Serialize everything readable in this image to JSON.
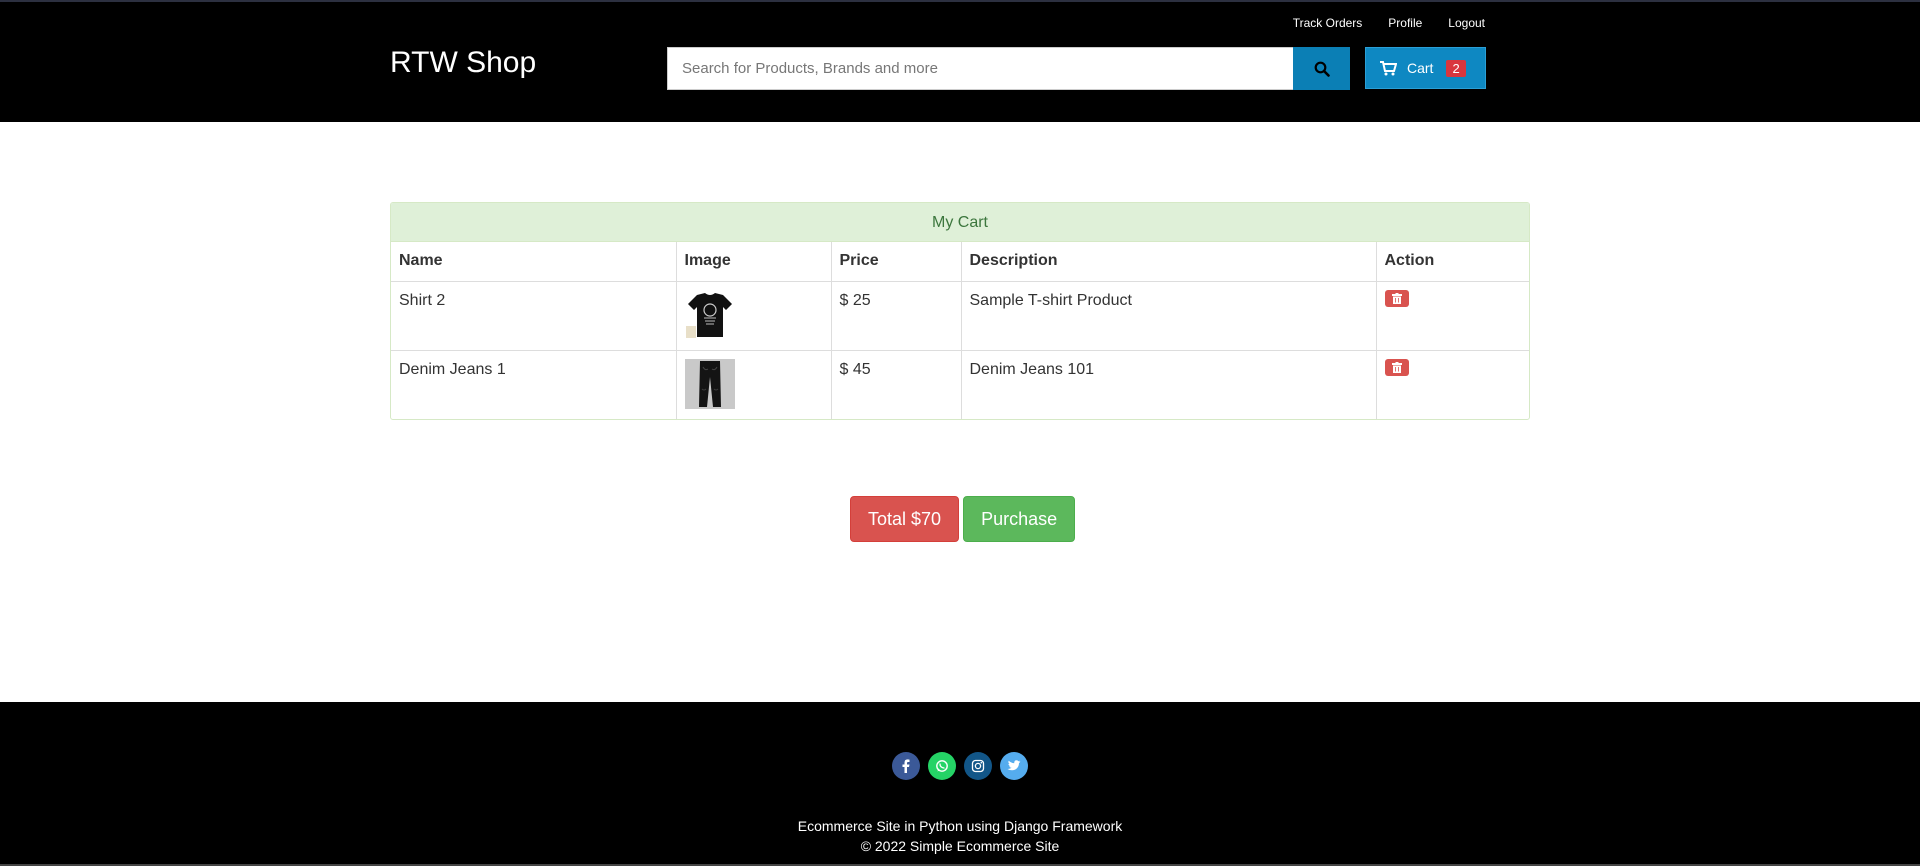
{
  "header": {
    "brand": "RTW Shop",
    "top_links": [
      "Track Orders",
      "Profile",
      "Logout"
    ],
    "search_placeholder": "Search for Products, Brands and more",
    "cart_label": "Cart",
    "cart_count": "2"
  },
  "cart": {
    "title": "My Cart",
    "columns": [
      "Name",
      "Image",
      "Price",
      "Description",
      "Action"
    ],
    "rows": [
      {
        "name": "Shirt 2",
        "image": "tshirt-image",
        "price": "$ 25",
        "description": "Sample T-shirt Product"
      },
      {
        "name": "Denim Jeans 1",
        "image": "jeans-image",
        "price": "$ 45",
        "description": "Denim Jeans 101"
      }
    ]
  },
  "summary": {
    "total_label": "Total $70",
    "purchase_label": "Purchase"
  },
  "footer": {
    "socials": [
      "facebook-icon",
      "whatsapp-icon",
      "instagram-icon",
      "twitter-icon"
    ],
    "line1": "Ecommerce Site in Python using Django Framework",
    "line2": "© 2022 Simple Ecommerce Site"
  },
  "colors": {
    "header_bg": "#000000",
    "search_button": "#0b7fb5",
    "cart_button": "#0e88c2",
    "panel_heading": "#dff0d8",
    "total_button": "#d9534f",
    "purchase_button": "#5cb85c"
  }
}
